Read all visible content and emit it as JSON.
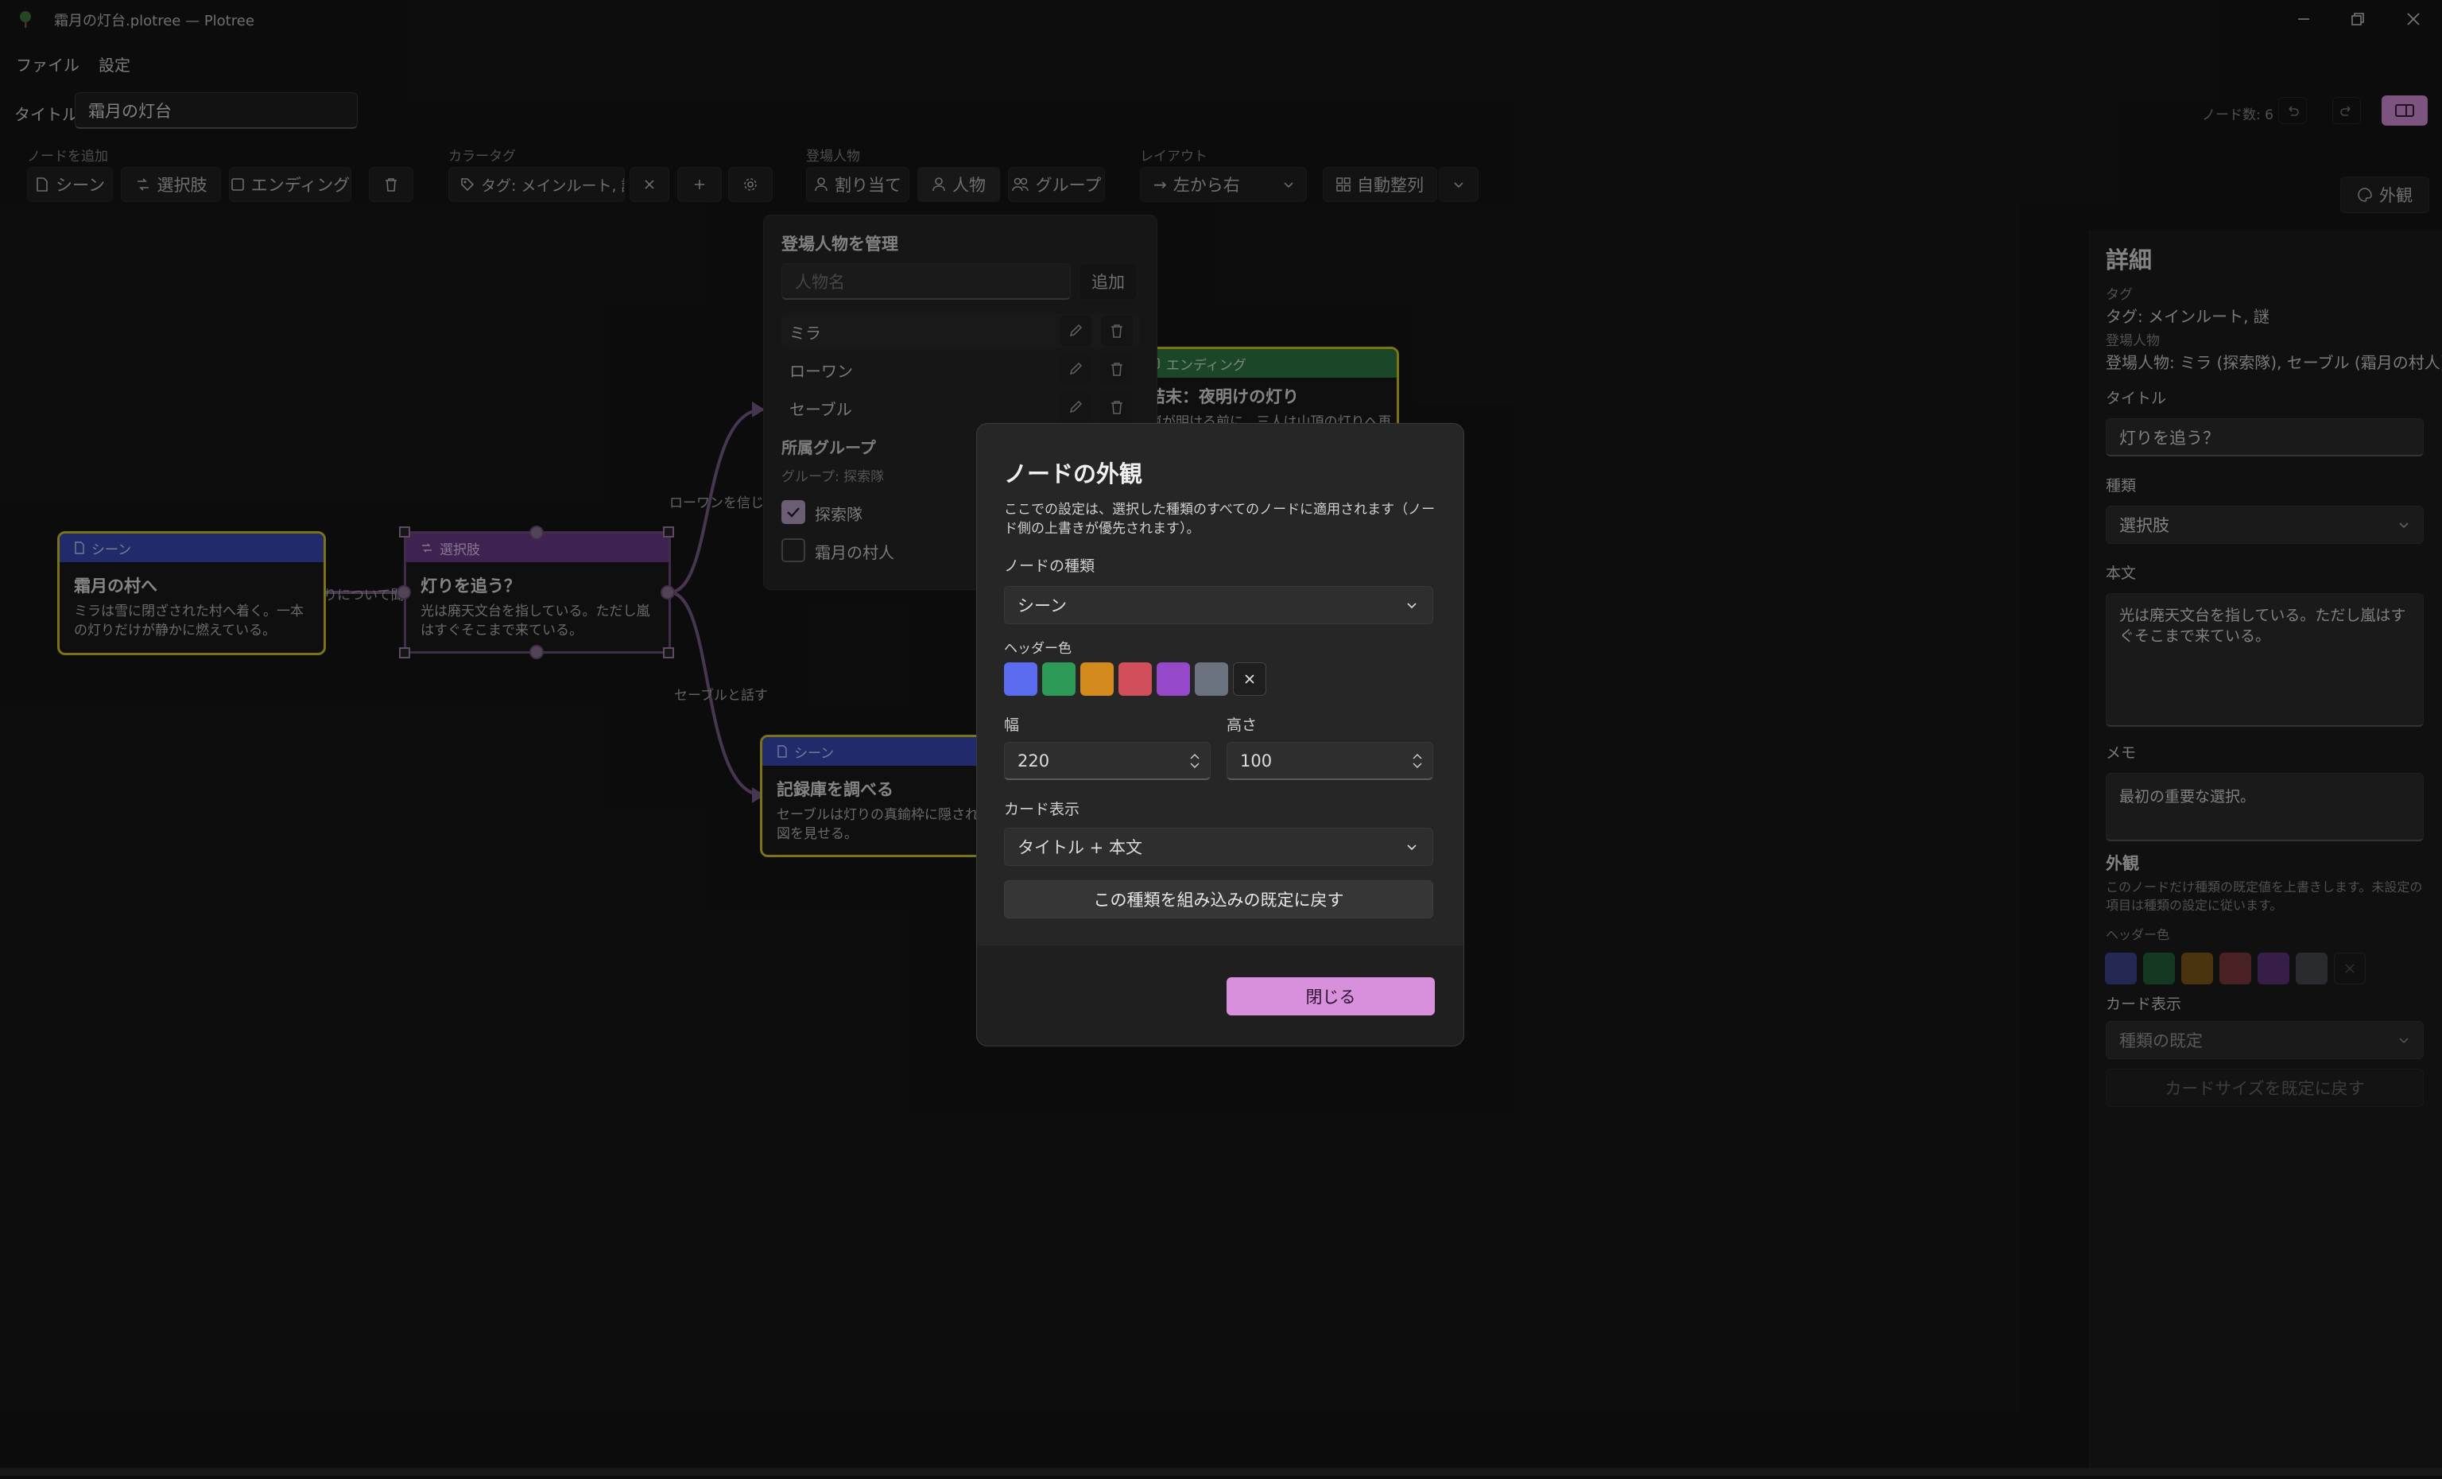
{
  "window": {
    "title": "霜月の灯台.plotree — Plotree"
  },
  "menu": {
    "file": "ファイル",
    "settings": "設定"
  },
  "title_field": {
    "label": "タイトル",
    "value": "霜月の灯台"
  },
  "node_count": "ノード数: 6",
  "toolbar": {
    "add_node": {
      "label": "ノードを追加",
      "scene": "シーン",
      "choice": "選択肢",
      "ending": "エンディング"
    },
    "color_tag": {
      "label": "カラータグ",
      "value": "タグ: メインルート, 謎"
    },
    "characters": {
      "label": "登場人物",
      "assign": "割り当て",
      "person": "人物",
      "group": "グループ"
    },
    "layout": {
      "label": "レイアウト",
      "direction": "左から右",
      "auto": "自動整列"
    },
    "appearance": "外観"
  },
  "characters_panel": {
    "title": "登場人物を管理",
    "name_placeholder": "人物名",
    "add": "追加",
    "people": [
      "ミラ",
      "ローワン",
      "セーブル"
    ],
    "group_title": "所属グループ",
    "group_current": "グループ: 探索隊",
    "groups": [
      {
        "name": "探索隊",
        "checked": true
      },
      {
        "name": "霜月の村人",
        "checked": false
      }
    ]
  },
  "nodes": {
    "n1": {
      "type": "シーン",
      "title": "霜月の村へ",
      "body": "ミラは雪に閉ざされた村へ着く。一本の灯りだけが静かに燃えている。"
    },
    "n2": {
      "type": "選択肢",
      "title": "灯りを追う？",
      "body": "光は廃天文台を指している。ただし嵐はすぐそこまで来ている。"
    },
    "n3": {
      "type": "エンディング",
      "title": "結末：夜明けの灯り",
      "body": "嵐が明ける前に、三人は山頂の灯りへ再"
    },
    "n4": {
      "type": "シーン",
      "title": "記録庫を調べる",
      "body": "セーブルは灯りの真鍮枠に隠された地図を見せる。"
    }
  },
  "edges": {
    "e1": "灯りについて聞く",
    "e2": "ローワンを信じる",
    "e3": "セーブルと話す"
  },
  "details": {
    "heading": "詳細",
    "tag_label": "タグ",
    "tag_value": "タグ: メインルート, 謎",
    "chars_label": "登場人物",
    "chars_value": "登場人物: ミラ (探索隊), セーブル (霜月の村人)",
    "title_label": "タイトル",
    "title_value": "灯りを追う？",
    "type_label": "種類",
    "type_value": "選択肢",
    "body_label": "本文",
    "body_value": "光は廃天文台を指している。ただし嵐はすぐそこまで来ている。",
    "memo_label": "メモ",
    "memo_value": "最初の重要な選択。",
    "appearance_title": "外観",
    "appearance_desc": "このノードだけ種類の既定値を上書きします。未設定の項目は種類の設定に従います。",
    "header_color_label": "ヘッダー色",
    "card_display_label": "カード表示",
    "card_display_value": "種類の既定",
    "reset_size": "カードサイズを既定に戻す"
  },
  "modal": {
    "title": "ノードの外観",
    "description": "ここでの設定は、選択した種類のすべてのノードに適用されます（ノード側の上書きが優先されます）。",
    "node_type_label": "ノードの種類",
    "node_type_value": "シーン",
    "header_color_label": "ヘッダー色",
    "swatches": [
      "#5b6cf0",
      "#2e9a57",
      "#d48a1c",
      "#d04f5a",
      "#9548c9",
      "#6b7280"
    ],
    "width_label": "幅",
    "width_value": "220",
    "height_label": "高さ",
    "height_value": "100",
    "card_display_label": "カード表示",
    "card_display_value": "タイトル + 本文",
    "reset_button": "この種類を組み込みの既定に戻す",
    "close_button": "閉じる"
  },
  "colors": {
    "accent": "#d890dc",
    "scene_header": "#3a4ab8",
    "choice_header": "#6c3c8c",
    "ending_header": "#2f7a45",
    "selection_outline": "#d6c42a"
  }
}
